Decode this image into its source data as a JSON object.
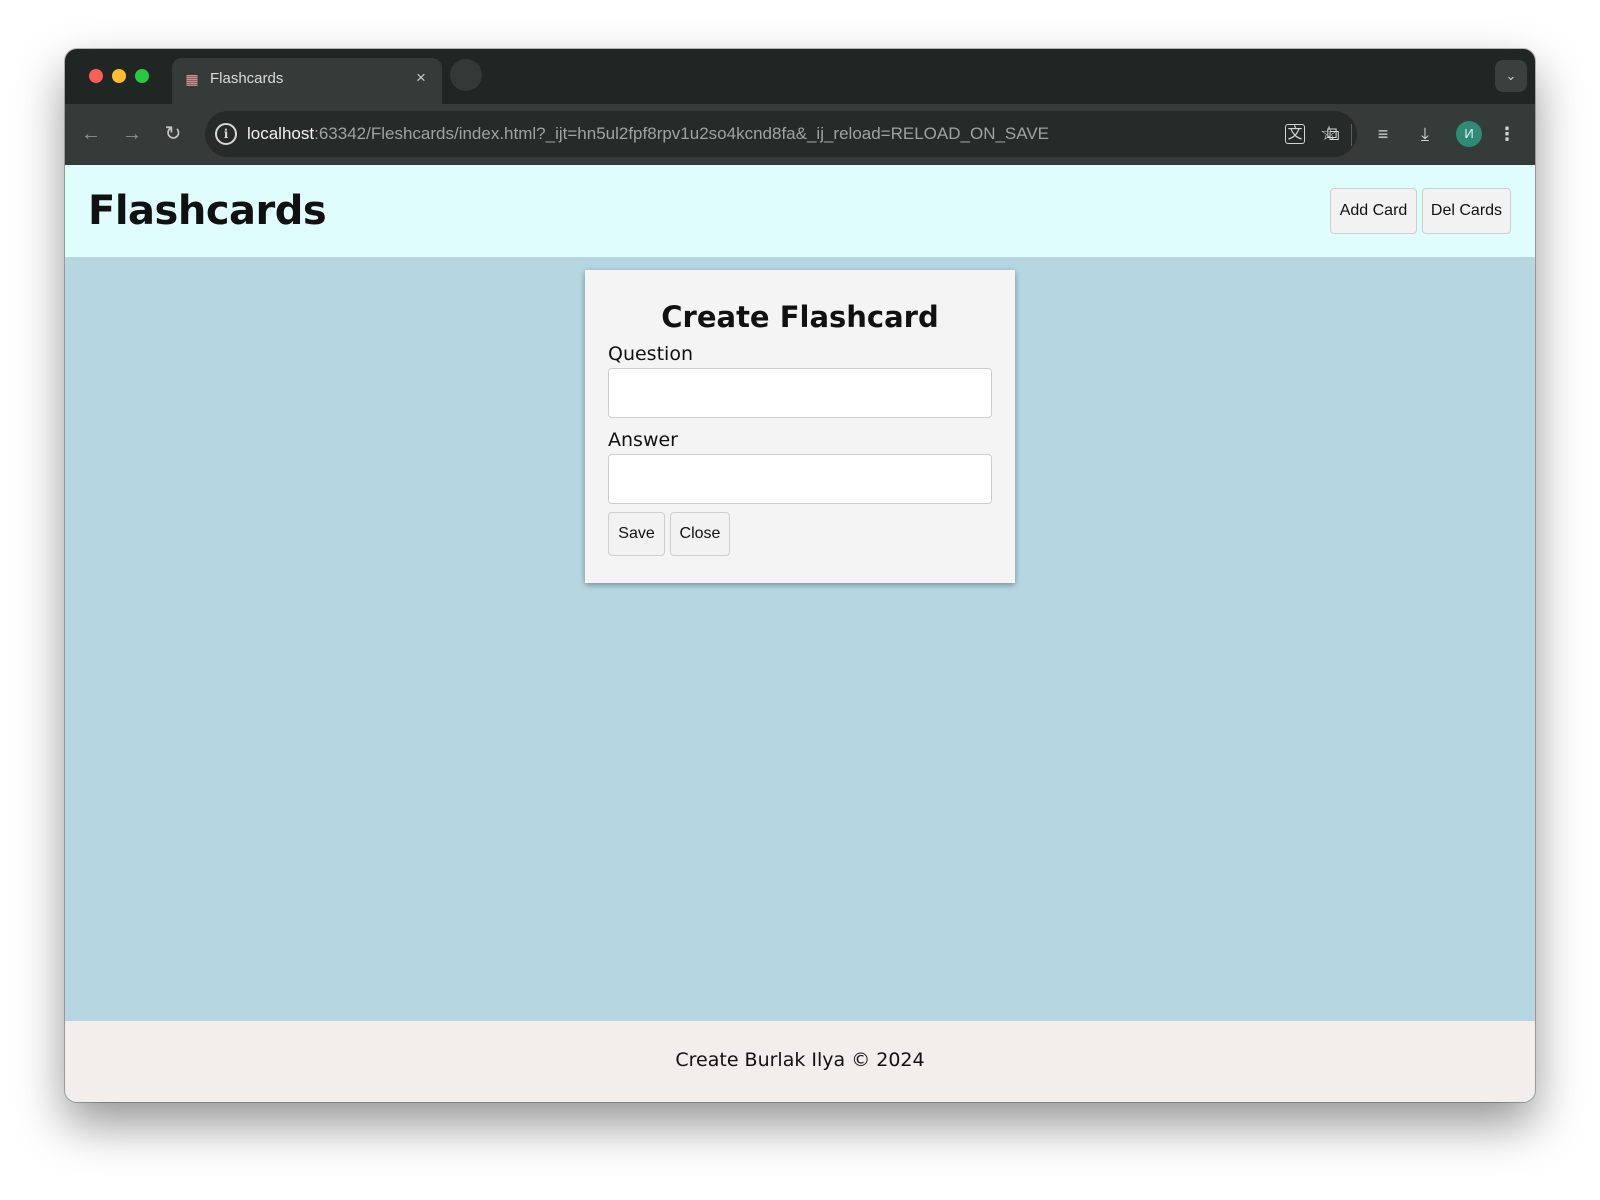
{
  "browser": {
    "tab": {
      "title": "Flashcards",
      "favicon": "flashcards-favicon-icon",
      "close_glyph": "×"
    },
    "tab_dropdown_glyph": "⌄",
    "nav": {
      "back_glyph": "←",
      "forward_glyph": "→",
      "reload_glyph": "↻"
    },
    "url": {
      "host": "localhost",
      "rest": ":63342/Fleshcards/index.html?_ijt=hn5ul2fpf8rpv1u2so4kcnd8fa&_ij_reload=RELOAD_ON_SAVE"
    },
    "profile_initial": "И",
    "colors": {
      "tabstrip": "#202623",
      "toolbar": "#353b38",
      "avatar": "#2f8a76"
    }
  },
  "header": {
    "title": "Flashcards",
    "add_card_label": "Add Card",
    "del_cards_label": "Del Cards"
  },
  "modal": {
    "title": "Create Flashcard",
    "question_label": "Question",
    "question_value": "",
    "answer_label": "Answer",
    "answer_value": "",
    "save_label": "Save",
    "close_label": "Close"
  },
  "footer": {
    "text": "Create Burlak Ilya © 2024"
  },
  "colors": {
    "header_bg": "#e0fdfd",
    "main_bg": "#b6d7e2",
    "modal_bg": "#f4f4f4",
    "footer_bg": "#f2eeeb"
  }
}
